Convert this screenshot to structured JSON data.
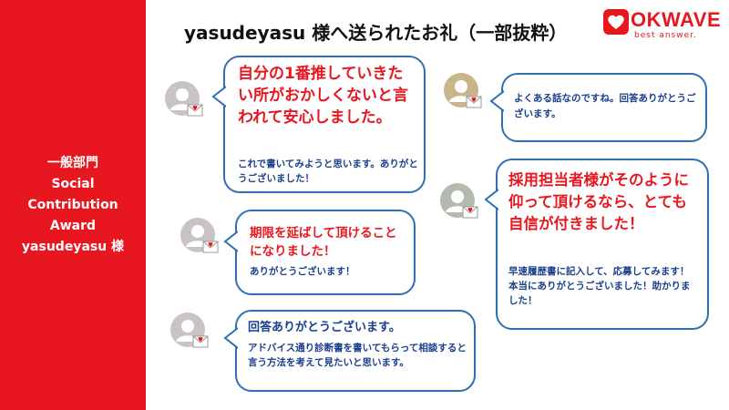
{
  "title": "yasudeyasu 様へ送られたお礼（一部抜粋）",
  "logo": {
    "brand": "OKWAVE",
    "tagline": "best answer."
  },
  "sidebar": {
    "line1": "一般部門",
    "line2": "Social",
    "line3": "Contribution",
    "line4": "Award",
    "line5": "yasudeyasu 様"
  },
  "messages": [
    {
      "big": "自分の1番推していきたい所がおかしくないと言われて安心しました。",
      "small": "これで書いてみようと思います。ありがとうございました！"
    },
    {
      "big": "期限を延ばして頂けることになりました！",
      "small": "ありがとうございます！"
    },
    {
      "big": "回答ありがとうございます。",
      "small": "アドバイス通り診断書を書いてもらって相談すると言う方法を考えて見たいと思います。"
    },
    {
      "small": "よくある話なのですね。回答ありがとうございます。"
    },
    {
      "big": "採用担当者様がそのように仰って頂けるなら、とても自信が付きました！",
      "small": "早速履歴書に記入して、応募してみます！本当にありがとうございました！助かりました！"
    }
  ],
  "colors": {
    "accent": "#e8171f",
    "bubble_border": "#2f6fb5",
    "small_text": "#1a3f8c"
  },
  "icons": {
    "avatar": "user-avatar-icon",
    "envelope": "heart-envelope-icon"
  }
}
